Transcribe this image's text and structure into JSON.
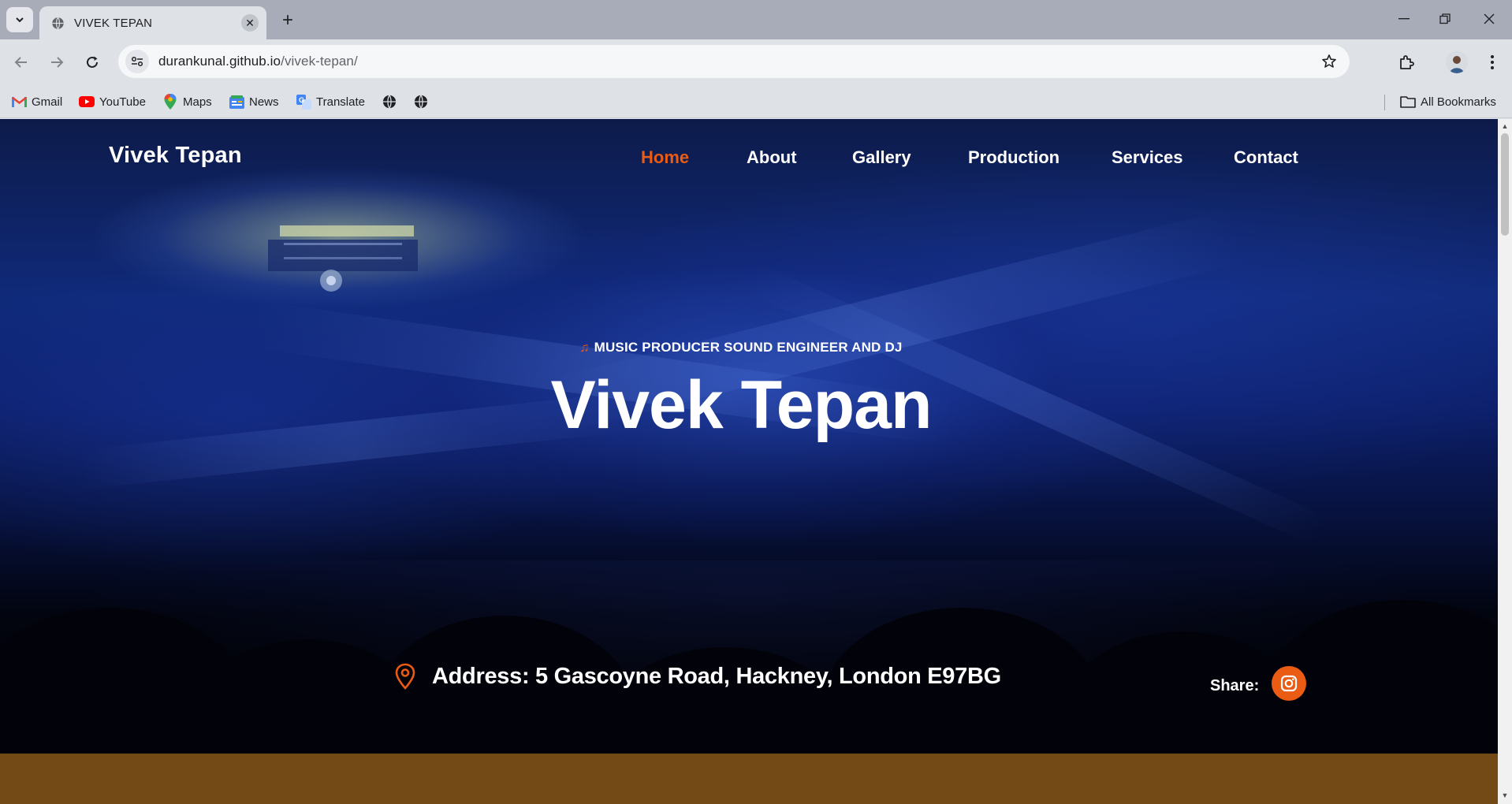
{
  "browser": {
    "tab_title": "VIVEK TEPAN",
    "url_host": "durankunal.github.io",
    "url_path": "/vivek-tepan/",
    "bookmarks": [
      {
        "label": "Gmail",
        "icon": "gmail-icon"
      },
      {
        "label": "YouTube",
        "icon": "youtube-icon"
      },
      {
        "label": "Maps",
        "icon": "maps-icon"
      },
      {
        "label": "News",
        "icon": "news-icon"
      },
      {
        "label": "Translate",
        "icon": "translate-icon"
      }
    ],
    "all_bookmarks": "All Bookmarks"
  },
  "site": {
    "logo": "Vivek Tepan",
    "nav": [
      {
        "label": "Home",
        "active": true
      },
      {
        "label": "About",
        "active": false
      },
      {
        "label": "Gallery",
        "active": false
      },
      {
        "label": "Production",
        "active": false
      },
      {
        "label": "Services",
        "active": false
      },
      {
        "label": "Contact",
        "active": false
      }
    ],
    "tagline": "MUSIC PRODUCER SOUND ENGINEER AND DJ",
    "title": "Vivek Tepan",
    "address": "Address: 5 Gascoyne Road, Hackney, London E97BG",
    "share_label": "Share:"
  },
  "colors": {
    "accent": "#ea5b14",
    "footer_band": "#734a16",
    "text": "#ffffff"
  }
}
